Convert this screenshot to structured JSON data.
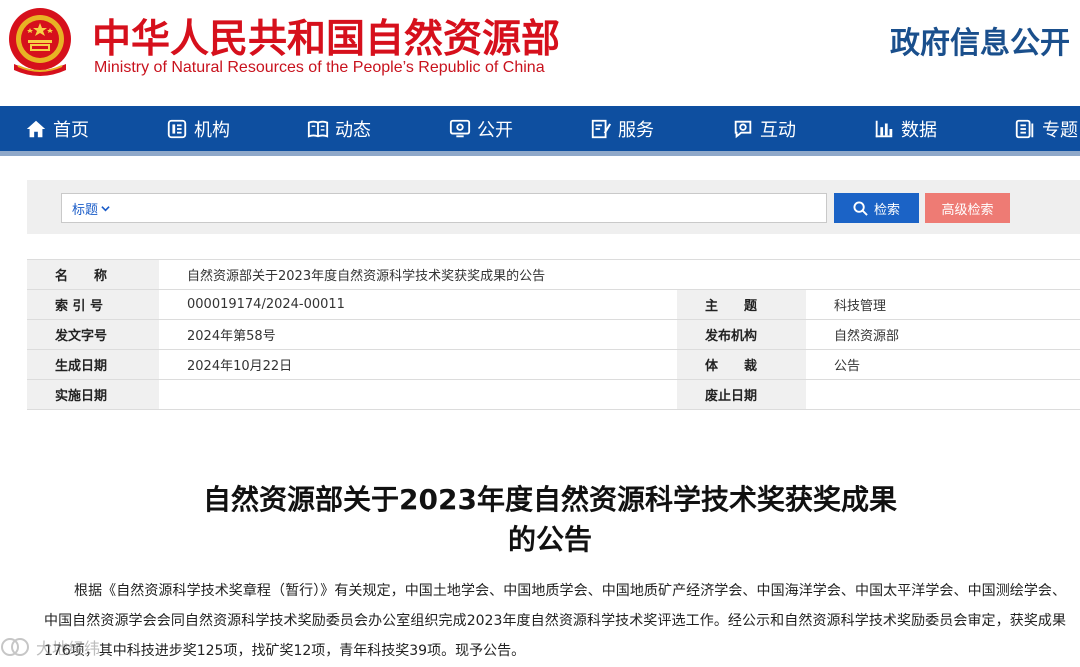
{
  "header": {
    "title_cn": "中华人民共和国自然资源部",
    "title_en": "Ministry of Natural Resources of the People’s Republic of China",
    "gov_info": "政府信息公开"
  },
  "nav": {
    "items": [
      {
        "label": "首页",
        "icon": "home-icon"
      },
      {
        "label": "机构",
        "icon": "org-icon"
      },
      {
        "label": "动态",
        "icon": "book-icon"
      },
      {
        "label": "公开",
        "icon": "monitor-icon"
      },
      {
        "label": "服务",
        "icon": "edit-document-icon"
      },
      {
        "label": "互动",
        "icon": "chat-icon"
      },
      {
        "label": "数据",
        "icon": "bar-chart-icon"
      },
      {
        "label": "专题",
        "icon": "topic-icon"
      }
    ]
  },
  "search": {
    "field_type": "标题",
    "placeholder": "",
    "search_label": "检索",
    "advanced_label": "高级检索"
  },
  "meta": {
    "name_label": "名　　称",
    "name_value": "自然资源部关于2023年度自然资源科学技术奖获奖成果的公告",
    "index_label": "索 引 号",
    "index_value": "000019174/2024-00011",
    "subject_label": "主　　题",
    "subject_value": "科技管理",
    "doc_no_label": "发文字号",
    "doc_no_value": "2024年第58号",
    "issuer_label": "发布机构",
    "issuer_value": "自然资源部",
    "created_label": "生成日期",
    "created_value": "2024年10月22日",
    "genre_label": "体　　裁",
    "genre_value": "公告",
    "effective_label": "实施日期",
    "effective_value": "",
    "expiry_label": "废止日期",
    "expiry_value": ""
  },
  "article": {
    "title_line1": "自然资源部关于2023年度自然资源科学技术奖获奖成果",
    "title_line2": "的公告",
    "body": "根据《自然资源科学技术奖章程（暂行）》有关规定，中国土地学会、中国地质学会、中国地质矿产经济学会、中国海洋学会、中国太平洋学会、中国测绘学会、中国自然资源学会会同自然资源科学技术奖励委员会办公室组织完成2023年度自然资源科学技术奖评选工作。经公示和自然资源科学技术奖励委员会审定，获奖成果176项，其中科技进步奖125项，找矿奖12项，青年科技奖39项。现予公告。"
  },
  "watermark": {
    "text": "大地经纬"
  },
  "colors": {
    "brand_red": "#d6101c",
    "nav_blue": "#0e4fa0",
    "search_blue": "#1b63c6",
    "advanced_pink": "#ee7b74",
    "gov_blue": "#1a4f8c"
  }
}
